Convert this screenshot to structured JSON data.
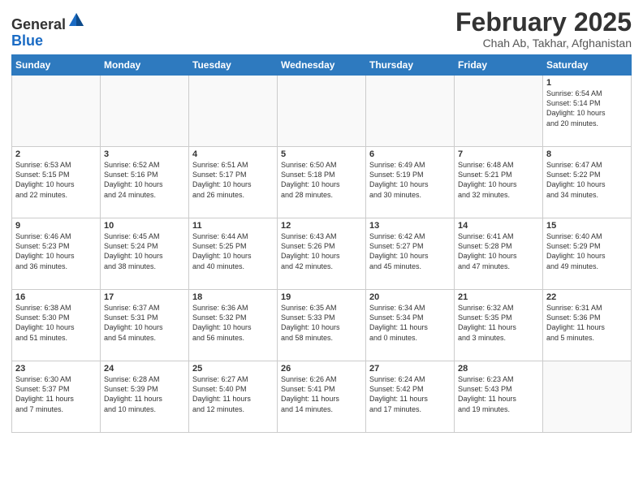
{
  "header": {
    "logo_general": "General",
    "logo_blue": "Blue",
    "month_title": "February 2025",
    "location": "Chah Ab, Takhar, Afghanistan"
  },
  "days_of_week": [
    "Sunday",
    "Monday",
    "Tuesday",
    "Wednesday",
    "Thursday",
    "Friday",
    "Saturday"
  ],
  "weeks": [
    [
      {
        "day": "",
        "info": ""
      },
      {
        "day": "",
        "info": ""
      },
      {
        "day": "",
        "info": ""
      },
      {
        "day": "",
        "info": ""
      },
      {
        "day": "",
        "info": ""
      },
      {
        "day": "",
        "info": ""
      },
      {
        "day": "1",
        "info": "Sunrise: 6:54 AM\nSunset: 5:14 PM\nDaylight: 10 hours\nand 20 minutes."
      }
    ],
    [
      {
        "day": "2",
        "info": "Sunrise: 6:53 AM\nSunset: 5:15 PM\nDaylight: 10 hours\nand 22 minutes."
      },
      {
        "day": "3",
        "info": "Sunrise: 6:52 AM\nSunset: 5:16 PM\nDaylight: 10 hours\nand 24 minutes."
      },
      {
        "day": "4",
        "info": "Sunrise: 6:51 AM\nSunset: 5:17 PM\nDaylight: 10 hours\nand 26 minutes."
      },
      {
        "day": "5",
        "info": "Sunrise: 6:50 AM\nSunset: 5:18 PM\nDaylight: 10 hours\nand 28 minutes."
      },
      {
        "day": "6",
        "info": "Sunrise: 6:49 AM\nSunset: 5:19 PM\nDaylight: 10 hours\nand 30 minutes."
      },
      {
        "day": "7",
        "info": "Sunrise: 6:48 AM\nSunset: 5:21 PM\nDaylight: 10 hours\nand 32 minutes."
      },
      {
        "day": "8",
        "info": "Sunrise: 6:47 AM\nSunset: 5:22 PM\nDaylight: 10 hours\nand 34 minutes."
      }
    ],
    [
      {
        "day": "9",
        "info": "Sunrise: 6:46 AM\nSunset: 5:23 PM\nDaylight: 10 hours\nand 36 minutes."
      },
      {
        "day": "10",
        "info": "Sunrise: 6:45 AM\nSunset: 5:24 PM\nDaylight: 10 hours\nand 38 minutes."
      },
      {
        "day": "11",
        "info": "Sunrise: 6:44 AM\nSunset: 5:25 PM\nDaylight: 10 hours\nand 40 minutes."
      },
      {
        "day": "12",
        "info": "Sunrise: 6:43 AM\nSunset: 5:26 PM\nDaylight: 10 hours\nand 42 minutes."
      },
      {
        "day": "13",
        "info": "Sunrise: 6:42 AM\nSunset: 5:27 PM\nDaylight: 10 hours\nand 45 minutes."
      },
      {
        "day": "14",
        "info": "Sunrise: 6:41 AM\nSunset: 5:28 PM\nDaylight: 10 hours\nand 47 minutes."
      },
      {
        "day": "15",
        "info": "Sunrise: 6:40 AM\nSunset: 5:29 PM\nDaylight: 10 hours\nand 49 minutes."
      }
    ],
    [
      {
        "day": "16",
        "info": "Sunrise: 6:38 AM\nSunset: 5:30 PM\nDaylight: 10 hours\nand 51 minutes."
      },
      {
        "day": "17",
        "info": "Sunrise: 6:37 AM\nSunset: 5:31 PM\nDaylight: 10 hours\nand 54 minutes."
      },
      {
        "day": "18",
        "info": "Sunrise: 6:36 AM\nSunset: 5:32 PM\nDaylight: 10 hours\nand 56 minutes."
      },
      {
        "day": "19",
        "info": "Sunrise: 6:35 AM\nSunset: 5:33 PM\nDaylight: 10 hours\nand 58 minutes."
      },
      {
        "day": "20",
        "info": "Sunrise: 6:34 AM\nSunset: 5:34 PM\nDaylight: 11 hours\nand 0 minutes."
      },
      {
        "day": "21",
        "info": "Sunrise: 6:32 AM\nSunset: 5:35 PM\nDaylight: 11 hours\nand 3 minutes."
      },
      {
        "day": "22",
        "info": "Sunrise: 6:31 AM\nSunset: 5:36 PM\nDaylight: 11 hours\nand 5 minutes."
      }
    ],
    [
      {
        "day": "23",
        "info": "Sunrise: 6:30 AM\nSunset: 5:37 PM\nDaylight: 11 hours\nand 7 minutes."
      },
      {
        "day": "24",
        "info": "Sunrise: 6:28 AM\nSunset: 5:39 PM\nDaylight: 11 hours\nand 10 minutes."
      },
      {
        "day": "25",
        "info": "Sunrise: 6:27 AM\nSunset: 5:40 PM\nDaylight: 11 hours\nand 12 minutes."
      },
      {
        "day": "26",
        "info": "Sunrise: 6:26 AM\nSunset: 5:41 PM\nDaylight: 11 hours\nand 14 minutes."
      },
      {
        "day": "27",
        "info": "Sunrise: 6:24 AM\nSunset: 5:42 PM\nDaylight: 11 hours\nand 17 minutes."
      },
      {
        "day": "28",
        "info": "Sunrise: 6:23 AM\nSunset: 5:43 PM\nDaylight: 11 hours\nand 19 minutes."
      },
      {
        "day": "",
        "info": ""
      }
    ]
  ]
}
